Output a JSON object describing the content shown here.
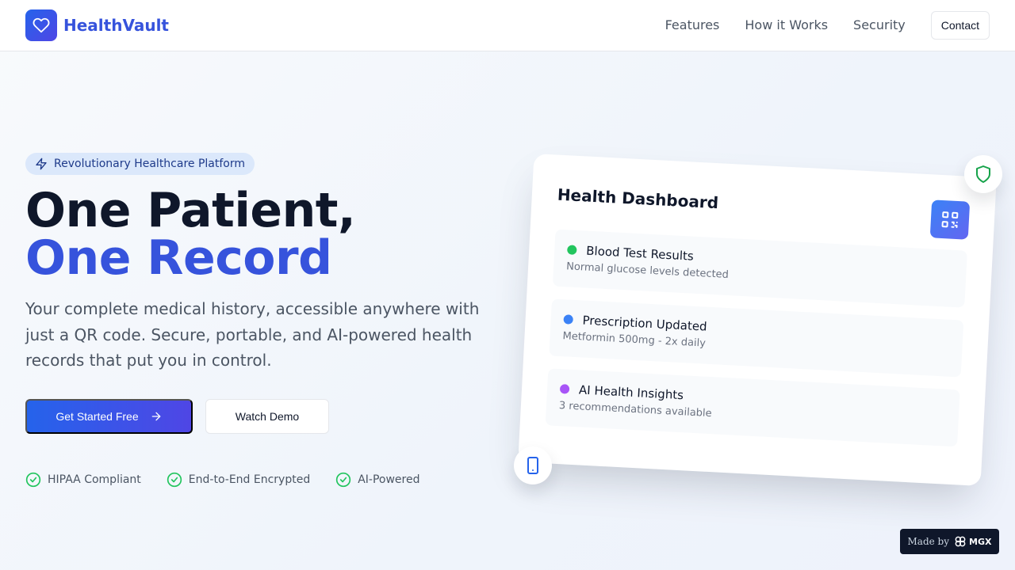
{
  "header": {
    "brand": "HealthVault",
    "logo_icon": "heart-icon",
    "nav": [
      {
        "label": "Features"
      },
      {
        "label": "How it Works"
      },
      {
        "label": "Security"
      }
    ],
    "contact_label": "Contact"
  },
  "hero": {
    "badge": "Revolutionary Healthcare Platform",
    "badge_icon": "bolt-icon",
    "title_line1": "One Patient,",
    "title_line2": "One Record",
    "description": "Your complete medical history, accessible anywhere with just a QR code. Secure, portable, and AI-powered health records that put you in control.",
    "primary_cta": "Get Started Free",
    "secondary_cta": "Watch Demo",
    "features": [
      {
        "label": "HIPAA Compliant",
        "icon": "check-circle-icon"
      },
      {
        "label": "End-to-End Encrypted",
        "icon": "check-circle-icon"
      },
      {
        "label": "AI-Powered",
        "icon": "check-circle-icon"
      }
    ]
  },
  "dashboard": {
    "title": "Health Dashboard",
    "qr_icon": "qr-code-icon",
    "items": [
      {
        "title": "Blood Test Results",
        "subtitle": "Normal glucose levels detected",
        "color": "#22c55e"
      },
      {
        "title": "Prescription Updated",
        "subtitle": "Metformin 500mg - 2x daily",
        "color": "#3b82f6"
      },
      {
        "title": "AI Health Insights",
        "subtitle": "3 recommendations available",
        "color": "#a855f7"
      }
    ]
  },
  "badges": {
    "made_by_label": "Made by",
    "made_by_brand": "MGX"
  },
  "colors": {
    "primary": "#3653dc",
    "green": "#22c55e",
    "blue": "#3b82f6",
    "purple": "#a855f7"
  }
}
